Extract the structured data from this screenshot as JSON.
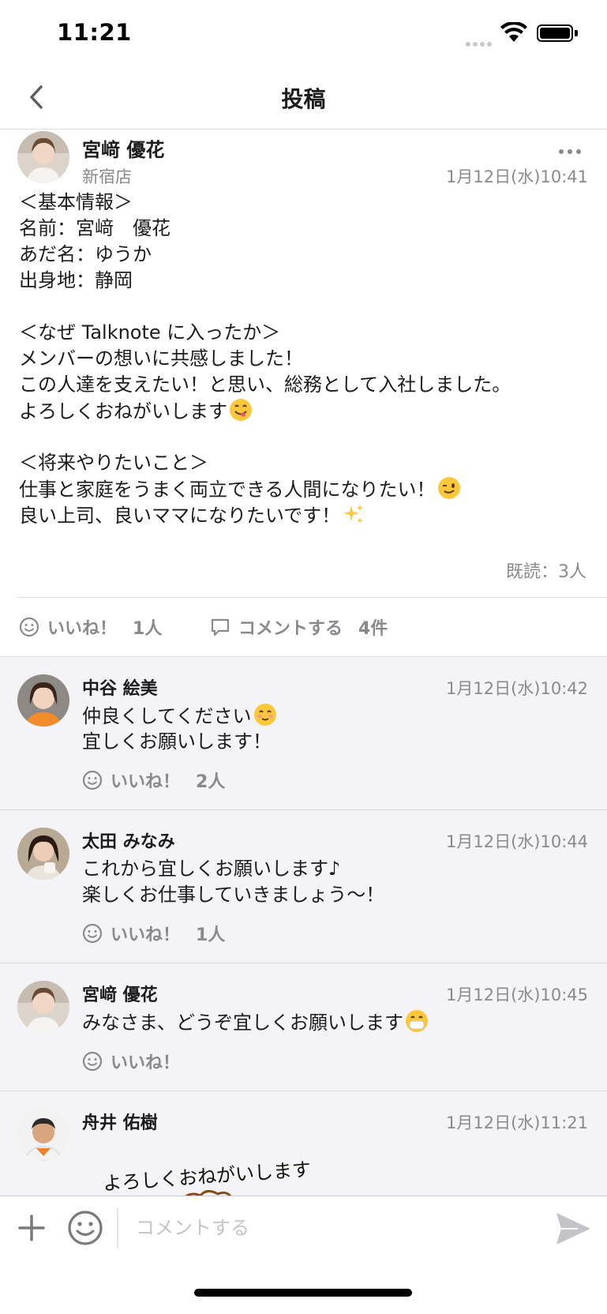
{
  "status_bar": {
    "time": "11:21"
  },
  "nav": {
    "title": "投稿"
  },
  "post": {
    "author": "宮﨑 優花",
    "store": "新宿店",
    "date": "1月12日(水)10:41",
    "body_lines": [
      "＜基本情報＞",
      "名前：宮﨑　優花",
      "あだ名：ゆうか",
      "出身地：静岡",
      "",
      "＜なぜ Talknote に入ったか＞",
      "メンバーの想いに共感しました！",
      "この人達を支えたい！と思い、総務として入社しました。",
      "よろしくおねがいします",
      "",
      "＜将来やりたいこと＞",
      "仕事と家庭をうまく両立できる人間になりたい！",
      "良い上司、良いママになりたいです！"
    ],
    "read_status": "既読：3人",
    "like_label": "いいね！",
    "like_count": "1人",
    "comment_label": "コメントする",
    "comment_count": "4件"
  },
  "comments": [
    {
      "author": "中谷 絵美",
      "date": "1月12日(水)10:42",
      "lines": [
        "仲良くしてください",
        "宜しくお願いします！"
      ],
      "like_label": "いいね！",
      "like_count": "2人"
    },
    {
      "author": "太田 みなみ",
      "date": "1月12日(水)10:44",
      "lines": [
        "これから宜しくお願いします♪",
        "楽しくお仕事していきましょう〜！"
      ],
      "like_label": "いいね！",
      "like_count": "1人"
    },
    {
      "author": "宮﨑 優花",
      "date": "1月12日(水)10:45",
      "lines": [
        "みなさま、どうぞ宜しくお願いします"
      ],
      "like_label": "いいね！",
      "like_count": ""
    },
    {
      "author": "舟井 佑樹",
      "date": "1月12日(水)11:21",
      "sticker_text": "よろしくおねがいします"
    }
  ],
  "input": {
    "placeholder": "コメントする"
  },
  "colors": {
    "accent": "#5b5bd6",
    "muted": "#8a8a8e",
    "comment_bg": "#f4f4f6"
  },
  "icons": [
    "back-chevron-icon",
    "more-icon",
    "smile-icon",
    "comment-bubble-icon",
    "plus-icon",
    "send-icon",
    "wifi-icon",
    "battery-icon"
  ]
}
